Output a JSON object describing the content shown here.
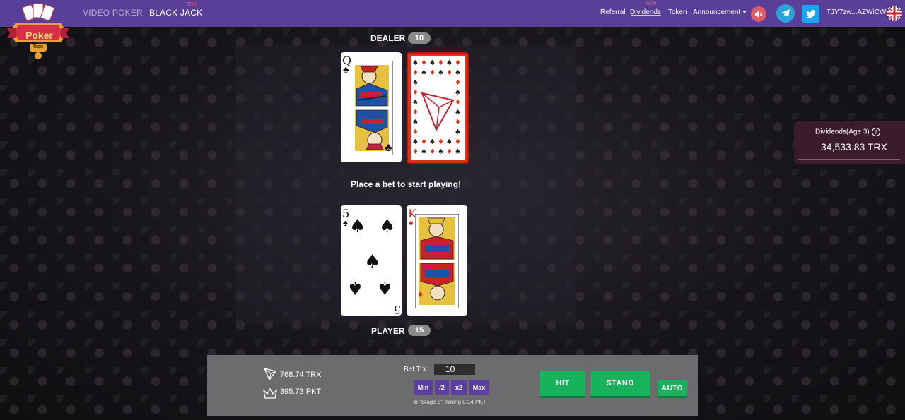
{
  "nav": {
    "logo_text": "Poker",
    "logo_sub": "Tron",
    "video_poker": "VIDEO POKER",
    "black_jack": "BLACK JACK",
    "black_jack_badge": "TRX",
    "referral": "Referral",
    "dividends": "Dividends",
    "dividends_badge": "NEW",
    "token": "Token",
    "announcement": "Announcement",
    "wallet": "TJY7zw...AZWiCW"
  },
  "dealer": {
    "label": "DEALER",
    "score": "10",
    "cards": [
      {
        "rank": "Q",
        "suit": "clubs",
        "suit_glyph": "♣"
      },
      {
        "face_down": true
      }
    ]
  },
  "message": "Place a bet to start playing!",
  "player": {
    "label": "PLAYER",
    "score": "15",
    "cards": [
      {
        "rank": "5",
        "suit": "spades",
        "suit_glyph": "♠"
      },
      {
        "rank": "K",
        "suit": "diamonds",
        "suit_glyph": "♦"
      }
    ]
  },
  "dividends_panel": {
    "title": "Dividends(Age 3)",
    "help": "?",
    "value": "34,533.83 TRX"
  },
  "bottom": {
    "trx_balance": "768.74 TRX",
    "pkt_balance": "395.73 PKT",
    "bet_label": "Bet Trx",
    "bet_value": "10",
    "min": "Min",
    "half": "/2",
    "double": "x2",
    "max": "Max",
    "mining": "In \"Stage 5\" mining 0.14 PKT",
    "hit": "HIT",
    "stand": "STAND",
    "auto": "AUTO"
  },
  "colors": {
    "nav": "#5a3f98",
    "accent_green": "#17b25c",
    "bet_btn": "#5c3fa0",
    "card_back": "#e0341c"
  }
}
